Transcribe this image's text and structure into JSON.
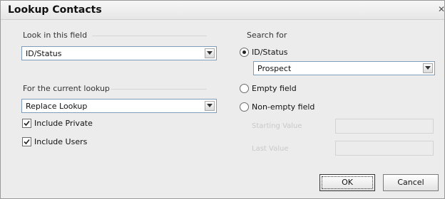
{
  "window": {
    "title": "Lookup Contacts",
    "close_glyph": "✕"
  },
  "look_in": {
    "label": "Look in this field",
    "value": "ID/Status"
  },
  "current_lookup": {
    "label": "For the current lookup",
    "value": "Replace Lookup"
  },
  "options": {
    "include_private": {
      "label": "Include Private",
      "checked": true
    },
    "include_users": {
      "label": "Include Users",
      "checked": true
    }
  },
  "search_for": {
    "label": "Search for",
    "radios": [
      {
        "label": "ID/Status",
        "selected": true
      },
      {
        "label": "Empty field",
        "selected": false
      },
      {
        "label": "Non-empty field",
        "selected": false
      }
    ],
    "value_combo": "Prospect",
    "range_from_label": "Starting Value",
    "range_to_label": "Last Value"
  },
  "buttons": {
    "ok": "OK",
    "cancel": "Cancel"
  }
}
